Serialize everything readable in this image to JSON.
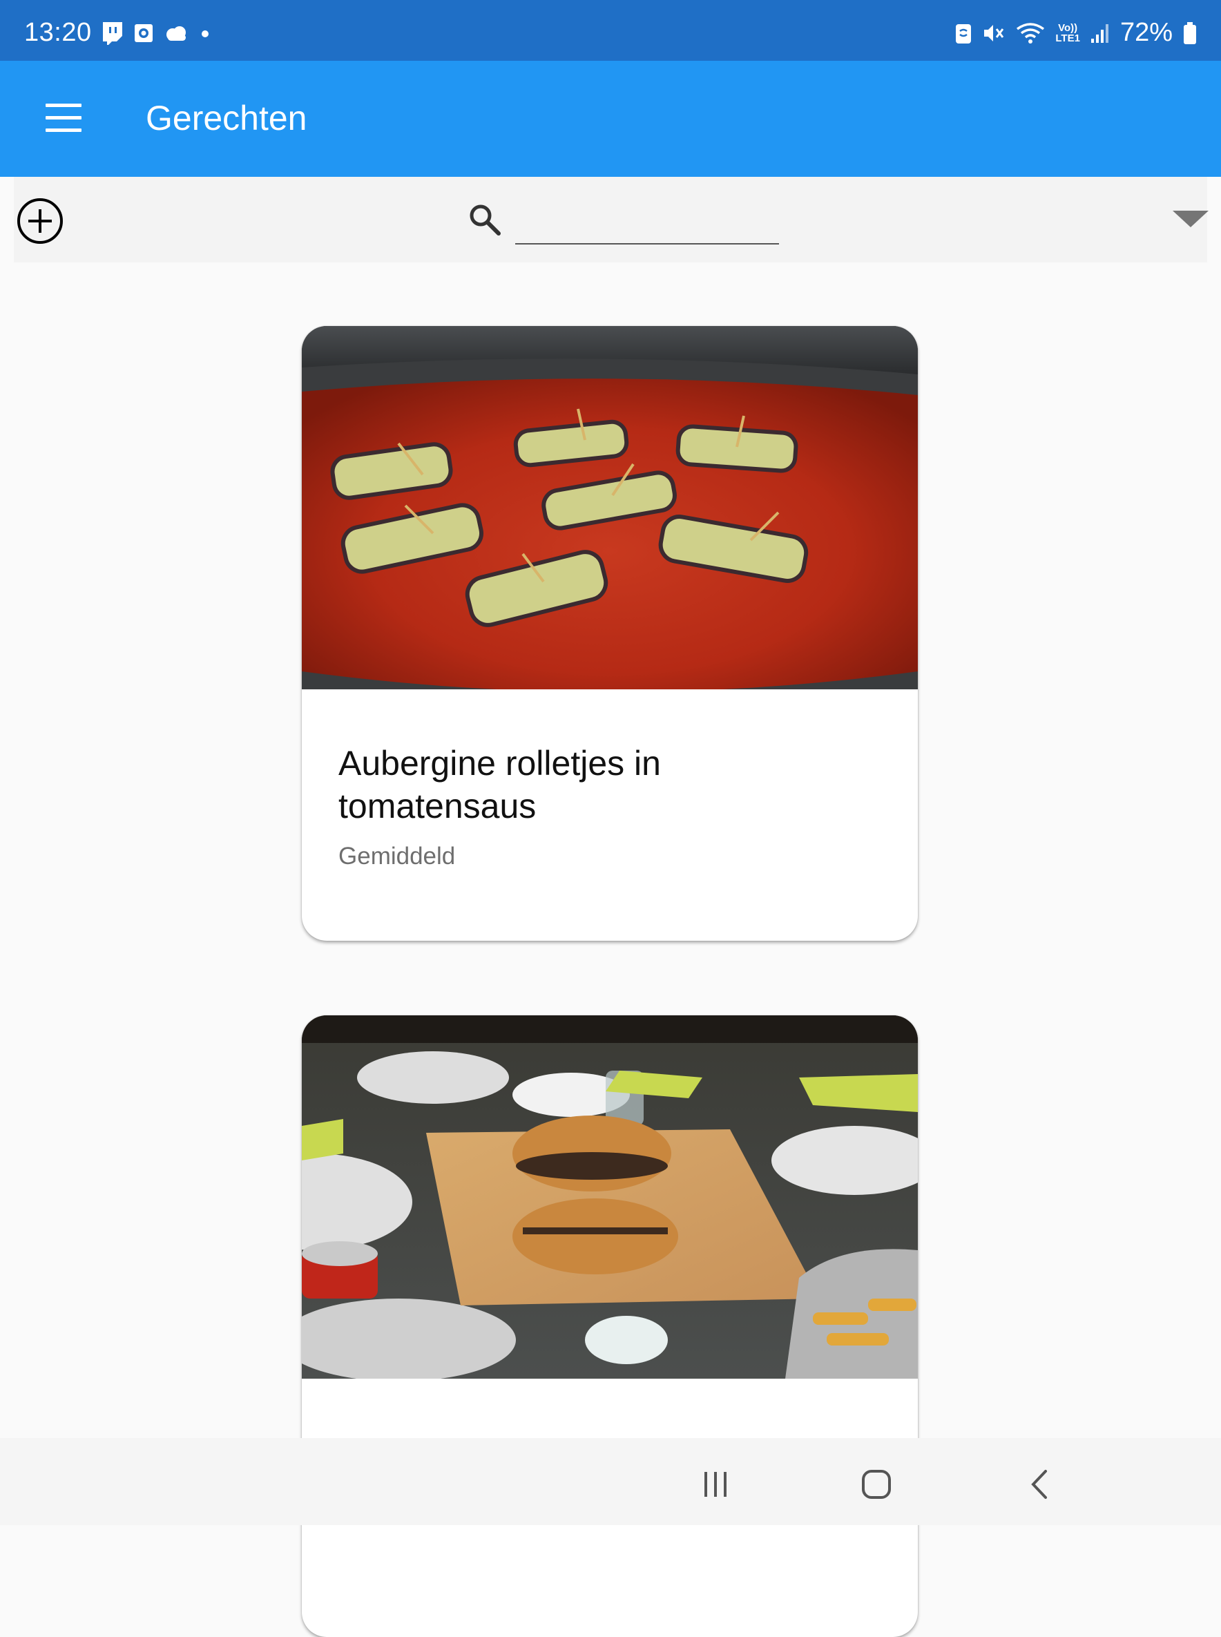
{
  "status_bar": {
    "time": "13:20",
    "battery": "72%",
    "left_icons": [
      "twitch-icon",
      "outlook-icon",
      "weather-cloud-icon",
      "dot-icon"
    ],
    "right_icons": [
      "nfc-icon",
      "mute-vibrate-icon",
      "wifi-icon",
      "volte-icon",
      "signal-icon",
      "battery-icon"
    ],
    "volte_label": "Vo))",
    "lte_label": "LTE1"
  },
  "app_bar": {
    "title": "Gerechten",
    "color": "#2196f3"
  },
  "toolbar": {
    "search_placeholder": "",
    "search_value": ""
  },
  "recipes": [
    {
      "title": "Aubergine rolletjes in tomatensaus",
      "difficulty": "Gemiddeld",
      "image": "aubergine-rolls-in-tomato-sauce-photo"
    },
    {
      "title": "",
      "difficulty": "",
      "image": "beef-wellington-on-cutting-board-photo"
    }
  ],
  "nav_bar": {
    "buttons": [
      "recent-apps-icon",
      "home-icon",
      "back-icon"
    ]
  }
}
